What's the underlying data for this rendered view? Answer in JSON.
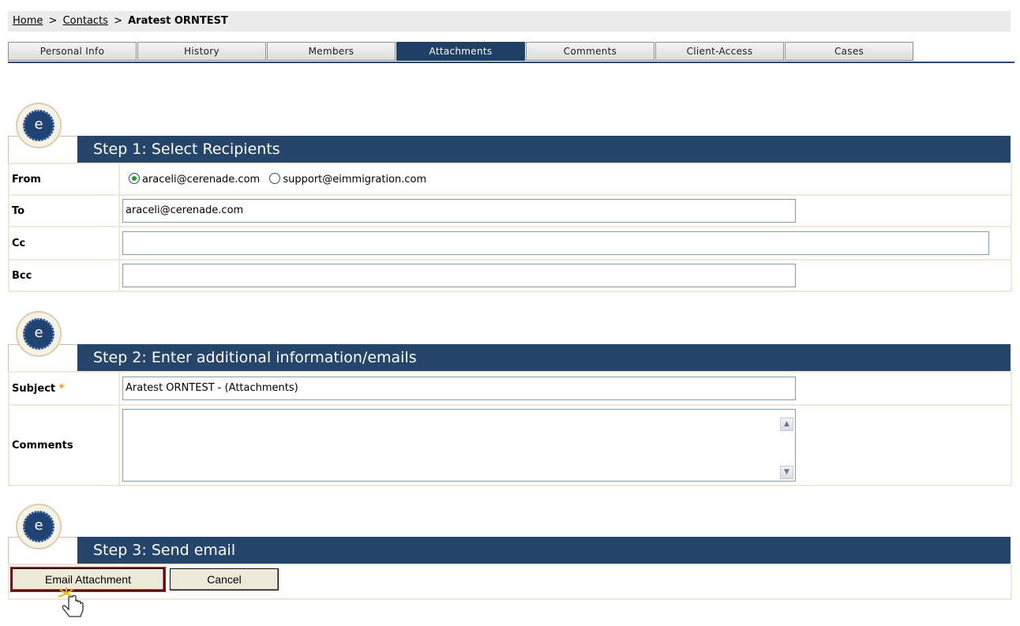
{
  "breadcrumb": {
    "home": "Home",
    "contacts": "Contacts",
    "separator": ">",
    "current": "Aratest  ORNTEST"
  },
  "tabs": [
    "Personal Info",
    "History",
    "Members",
    "Attachments",
    "Comments",
    "Client-Access",
    "Cases"
  ],
  "active_tab": "Attachments",
  "emblem_letter": "e",
  "step1": {
    "title": "Step 1: Select Recipients",
    "from_label": "From",
    "from_option_1": "araceli@cerenade.com",
    "from_option_2": "support@eimmigration.com",
    "to_label": "To",
    "to_value": "araceli@cerenade.com",
    "cc_label": "Cc",
    "cc_value": "",
    "bcc_label": "Bcc",
    "bcc_value": ""
  },
  "step2": {
    "title": "Step 2: Enter additional information/emails",
    "subject_label": "Subject",
    "required_mark": "*",
    "subject_value": "Aratest  ORNTEST - (Attachments)",
    "comments_label": "Comments",
    "comments_value": ""
  },
  "step3": {
    "title": "Step 3: Send email",
    "email_button": "Email Attachment",
    "cancel_button": "Cancel"
  },
  "colors": {
    "header_bar": "#26456b",
    "active_tab": "#1f3f66",
    "required_star": "#f08c00"
  }
}
